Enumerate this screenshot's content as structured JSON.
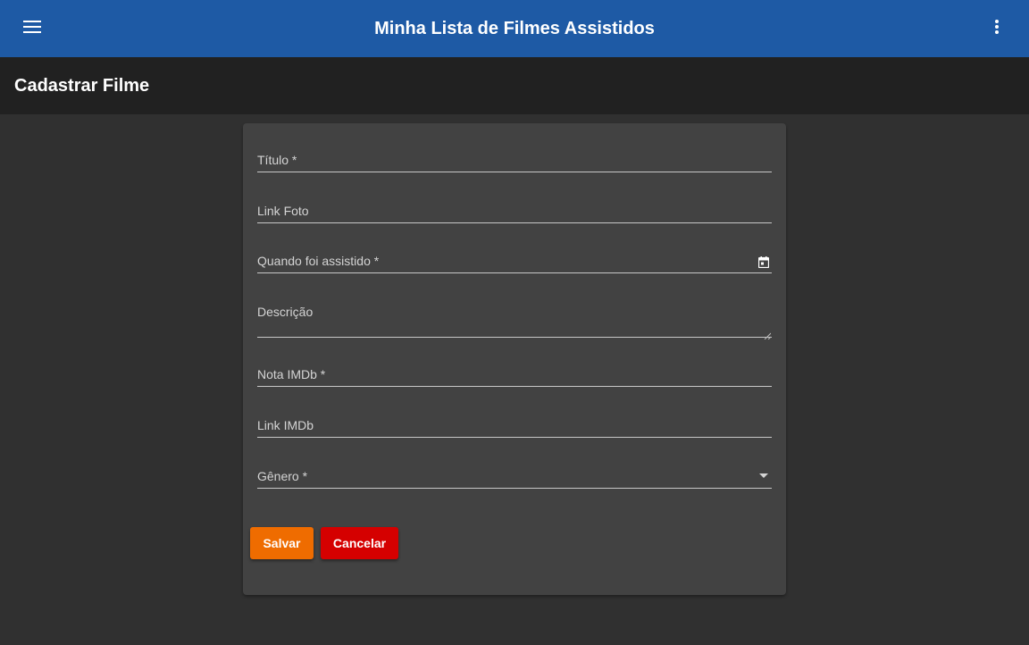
{
  "app": {
    "title": "Minha Lista de Filmes Assistidos",
    "toolbar_color": "#1e5aa5"
  },
  "toolbar": {
    "menu_icon": "menu-icon",
    "more_icon": "more-vert-icon"
  },
  "page": {
    "title": "Cadastrar Filme"
  },
  "form": {
    "fields": {
      "titulo": {
        "label": "Título *",
        "value": ""
      },
      "link_foto": {
        "label": "Link Foto",
        "value": ""
      },
      "quando_assistido": {
        "label": "Quando foi assistido *",
        "value": "",
        "icon": "calendar-icon"
      },
      "descricao": {
        "label": "Descrição",
        "value": ""
      },
      "nota_imdb": {
        "label": "Nota IMDb *",
        "value": ""
      },
      "link_imdb": {
        "label": "Link IMDb",
        "value": ""
      },
      "genero": {
        "label": "Gênero *",
        "value": "",
        "icon": "dropdown-arrow-icon"
      }
    },
    "buttons": {
      "save_label": "Salvar",
      "save_color": "#ef6c00",
      "cancel_label": "Cancelar",
      "cancel_color": "#d50000"
    }
  }
}
